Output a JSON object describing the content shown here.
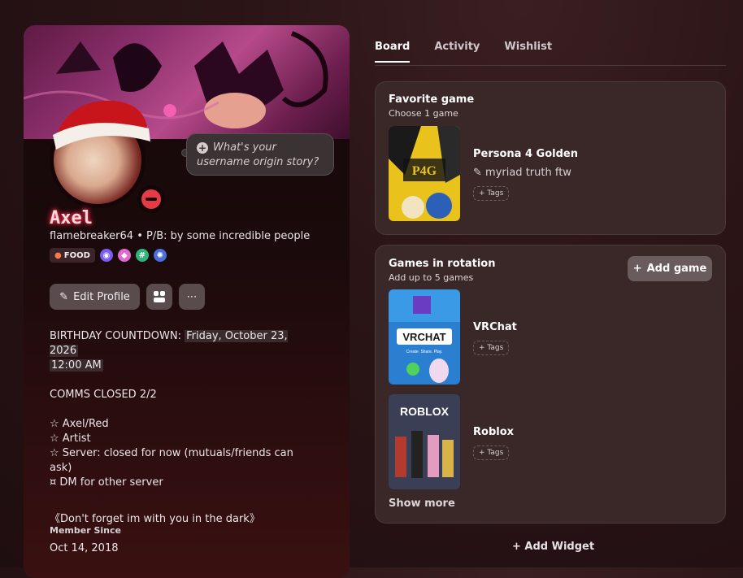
{
  "tabs": [
    {
      "label": "Board",
      "active": true
    },
    {
      "label": "Activity",
      "active": false
    },
    {
      "label": "Wishlist",
      "active": false
    }
  ],
  "profile": {
    "display_name": "Axel",
    "username": "flamebreaker64",
    "pronouns_bio": "P/B: by some incredible people",
    "prompt_bubble": "What's your username origin story?",
    "badge_food": "FOOD",
    "status": "do-not-disturb",
    "buttons": {
      "edit_profile": "Edit Profile",
      "more": "⋯"
    },
    "bio": {
      "line1_prefix": "BIRTHDAY COUNTDOWN: ",
      "line1_highlight": "Friday, October 23, 2026",
      "line2_highlight": "12:00 AM",
      "comms": "COMMS CLOSED 2/2",
      "item1": "☆ Axel/Red",
      "item2": "☆ Artist",
      "item3": "☆ Server: closed for now (mutuals/friends can ask)",
      "item4": "¤ DM for other server",
      "quote": "《Don't forget im with you in the dark》"
    },
    "member_since_label": "Member Since",
    "member_since": "Oct 14, 2018"
  },
  "favorite": {
    "title": "Favorite game",
    "subtitle": "Choose 1 game",
    "game": "Persona 4 Golden",
    "note": "myriad truth ftw",
    "tags": "+ Tags"
  },
  "rotation": {
    "title": "Games in rotation",
    "subtitle": "Add up to 5 games",
    "add_button": "Add game",
    "games": [
      {
        "name": "VRChat",
        "tags": "+ Tags"
      },
      {
        "name": "Roblox",
        "tags": "+ Tags"
      }
    ],
    "show_more": "Show more"
  },
  "add_widget": "Add Widget",
  "cover_text": {
    "p4g_logo": "P4G",
    "vrchat_logo": "VRCHAT",
    "vrchat_tagline": "Create. Share. Play.",
    "roblox_logo": "ROBLOX"
  }
}
